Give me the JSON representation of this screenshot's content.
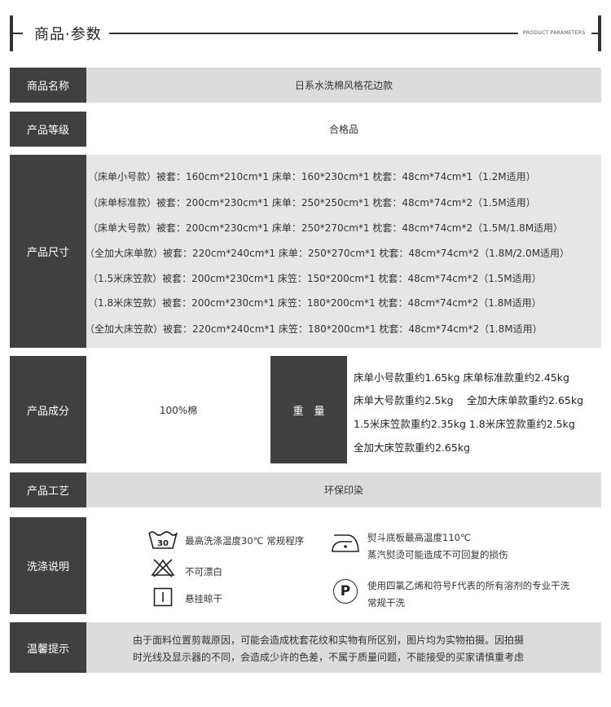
{
  "header": {
    "title": "商品·参数",
    "subtitle": "PRODUCT PARAMETERS"
  },
  "rows": {
    "name": {
      "label": "商品名称",
      "value": "日系水洗棉风格花边款"
    },
    "grade": {
      "label": "产品等级",
      "value": "合格品"
    },
    "size": {
      "label": "产品尺寸",
      "lines": [
        "（床单小号款）被套：160cm*210cm*1  床单：160*230cm*1  枕套：48cm*74cm*1（1.2M适用）",
        "（床单标准款）被套：200cm*230cm*1  床单：250*250cm*1  枕套：48cm*74cm*2（1.5M适用）",
        "（床单大号款）被套：200cm*230cm*1  床单：250*270cm*1  枕套：48cm*74cm*2（1.5M/1.8M适用）",
        "（全加大床单款）被套：220cm*240cm*1  床单：250*270cm*1  枕套：48cm*74cm*2（1.8M/2.0M适用）",
        "（1.5米床笠款）被套：200cm*230cm*1  床笠：150*200cm*1  枕套：48cm*74cm*2（1.5M适用）",
        "（1.8米床笠款）被套：200cm*230cm*1  床笠：180*200cm*1  枕套：48cm*74cm*2（1.8M适用）",
        "（全加大床笠款）被套：220cm*240cm*1  床笠：180*200cm*1  枕套：48cm*74cm*2（1.8M适用）"
      ]
    },
    "material": {
      "label": "产品成分",
      "value": "100%棉",
      "weight_label": "重　量",
      "weights": [
        "床单小号款重约1.65kg 床单标准款重约2.45kg",
        "床单大号款重约2.5kg　 全加大床单款重约2.65kg",
        "1.5米床笠款重约2.35kg 1.8米床笠款重约2.5kg",
        "全加大床笠款重约2.65kg"
      ]
    },
    "craft": {
      "label": "产品工艺",
      "value": "环保印染"
    },
    "wash": {
      "label": "洗涤说明",
      "wash_temp_number": "30",
      "items": {
        "temp": "最高洗涤温度30℃ 常规程序",
        "no_bleach": "不可漂白",
        "hang_dry": "悬挂晾干",
        "iron_line1": "熨斗底板最高温度110℃",
        "iron_line2": "蒸汽熨烫可能造成不可回复的损伤",
        "p_symbol": "P",
        "dryclean_line1": "使用四氯乙烯和符号F代表的所有溶剂的专业干洗",
        "dryclean_line2": "常规干洗"
      }
    },
    "tips": {
      "label": "温馨提示",
      "line1": "由于面料位置剪裁原因，可能会造成枕套花纹和实物有所区别，图片均为实物拍摄。因拍摄",
      "line2": "时光线及显示器的不同，会造成少许的色差，不属于质量问题，不能接受的买家请慎重考虑"
    }
  },
  "colors": {
    "label_bg": "#404040",
    "value_bg": "#dcdcdc",
    "size_bg": "#e6e6e6"
  }
}
